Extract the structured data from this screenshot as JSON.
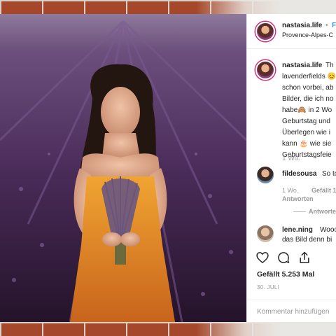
{
  "post": {
    "username": "nastasia.life",
    "follow_sep": "•",
    "follow_label": "F",
    "location": "Provence-Alpes-C",
    "caption_lines": [
      "Th",
      "lavenderfields 😊",
      "schon vorbei, ab",
      "Bilder, die ich no",
      "habe🙈 in 2 Wo",
      "Geburtstag und",
      "Überlegen wie i",
      "kann 🎂 wie sie",
      "Geburtstagsfeie"
    ],
    "caption_age": "1 Wo."
  },
  "comments": [
    {
      "username": "fildesousa",
      "text": "So to",
      "age": "1 Wo.",
      "likes": "Gefällt 1",
      "reply_label": "Antworten",
      "view_replies": "Antworten"
    },
    {
      "username": "lene.ning",
      "text": "Wooo",
      "text_line2": "das Bild denn bi"
    }
  ],
  "actions": {
    "like_icon": "heart-icon",
    "comment_icon": "comment-icon",
    "share_icon": "share-icon"
  },
  "likes_text": "Gefällt 5.253 Mal",
  "date": "30. JULI",
  "comment_placeholder": "Kommentar hinzufügen",
  "colors": {
    "link_blue": "#3897f0",
    "text": "#262626",
    "muted": "#999999",
    "brick": "#a4472a",
    "lavender": "#6f4d7a"
  }
}
